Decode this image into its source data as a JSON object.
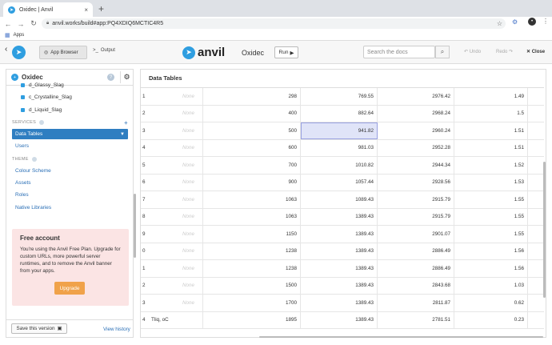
{
  "browser": {
    "tab_title": "Oxidec | Anvil",
    "url": "anvil.works/build#app:PQ4XDIQ6MCTIC4R5",
    "bookmarks_label": "Apps",
    "profile_initial": "•"
  },
  "app_header": {
    "app_browser_label": "App Browser",
    "output_label": "Output",
    "brand": "anvil",
    "app_name": "Oxidec",
    "run_label": "Run",
    "search_placeholder": "Search the docs",
    "undo_label": "Undo",
    "redo_label": "Redo",
    "close_label": "Close"
  },
  "sidebar": {
    "title": "Oxidec",
    "forms": [
      "d_Glassy_Slag",
      "c_Crystalline_Slag",
      "d_Liquid_Slag"
    ],
    "services_heading": "SERVICES",
    "data_tables": "Data Tables",
    "users": "Users",
    "theme_heading": "THEME",
    "theme_items": [
      "Colour Scheme",
      "Assets",
      "Roles",
      "Native Libraries"
    ],
    "promo": {
      "title": "Free account",
      "body": "You're using the Anvil Free Plan. Upgrade for custom URLs, more powerful server runtimes, and to remove the Anvil banner from your apps.",
      "upgrade": "Upgrade"
    },
    "save_version": "Save this version",
    "view_history": "View history"
  },
  "main": {
    "title": "Data Tables",
    "rows": [
      {
        "idx": "1",
        "c1": "None",
        "c2": "298",
        "c3": "769.55",
        "c4": "2976.42",
        "c5": "1.49"
      },
      {
        "idx": "2",
        "c1": "None",
        "c2": "400",
        "c3": "882.64",
        "c4": "2968.24",
        "c5": "1.5"
      },
      {
        "idx": "3",
        "c1": "None",
        "c2": "500",
        "c3": "941.82",
        "c4": "2960.24",
        "c5": "1.51"
      },
      {
        "idx": "4",
        "c1": "None",
        "c2": "600",
        "c3": "981.03",
        "c4": "2952.28",
        "c5": "1.51"
      },
      {
        "idx": "5",
        "c1": "None",
        "c2": "700",
        "c3": "1010.82",
        "c4": "2944.34",
        "c5": "1.52"
      },
      {
        "idx": "6",
        "c1": "None",
        "c2": "900",
        "c3": "1057.44",
        "c4": "2928.56",
        "c5": "1.53"
      },
      {
        "idx": "7",
        "c1": "None",
        "c2": "1063",
        "c3": "1089.43",
        "c4": "2915.79",
        "c5": "1.55"
      },
      {
        "idx": "8",
        "c1": "None",
        "c2": "1063",
        "c3": "1389.43",
        "c4": "2915.79",
        "c5": "1.55"
      },
      {
        "idx": "9",
        "c1": "None",
        "c2": "1150",
        "c3": "1389.43",
        "c4": "2901.07",
        "c5": "1.55"
      },
      {
        "idx": "0",
        "c1": "None",
        "c2": "1238",
        "c3": "1389.43",
        "c4": "2886.49",
        "c5": "1.56"
      },
      {
        "idx": "1",
        "c1": "None",
        "c2": "1238",
        "c3": "1389.43",
        "c4": "2886.49",
        "c5": "1.56"
      },
      {
        "idx": "2",
        "c1": "None",
        "c2": "1500",
        "c3": "1389.43",
        "c4": "2843.68",
        "c5": "1.03"
      },
      {
        "idx": "3",
        "c1": "None",
        "c2": "1700",
        "c3": "1389.43",
        "c4": "2811.87",
        "c5": "0.62"
      },
      {
        "idx": "4",
        "c1": "Tliq, oC",
        "c2": "1895",
        "c3": "1389.43",
        "c4": "2781.51",
        "c5": "0.23"
      }
    ]
  }
}
